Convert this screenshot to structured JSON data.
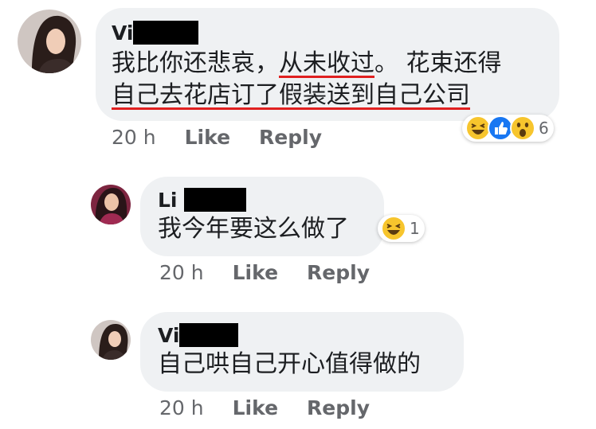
{
  "comments": [
    {
      "name_visible": "Vi",
      "text_plain_1": "我比你还悲哀，",
      "text_underline_1": "从未收过",
      "text_plain_2": "。 花束还得",
      "text_line2": "自己去花店订了假装送到自己公司",
      "time": "20 h",
      "like_label": "Like",
      "reply_label": "Reply",
      "reaction_icons": [
        "haha-icon",
        "like-icon",
        "wow-icon"
      ],
      "reaction_count": "6"
    },
    {
      "name_visible": "Li",
      "text": "我今年要这么做了",
      "time": "20 h",
      "like_label": "Like",
      "reply_label": "Reply",
      "reaction_icons": [
        "haha-icon"
      ],
      "reaction_count": "1"
    },
    {
      "name_visible": "Vi",
      "text": "自己哄自己开心值得做的",
      "time": "20 h",
      "like_label": "Like",
      "reply_label": "Reply"
    }
  ],
  "colors": {
    "bubble": "#eff1f3",
    "underline": "#e02020",
    "meta_text": "#65676b",
    "like_blue": "#1877f2",
    "emoji_yellow": "#f7c52d"
  }
}
